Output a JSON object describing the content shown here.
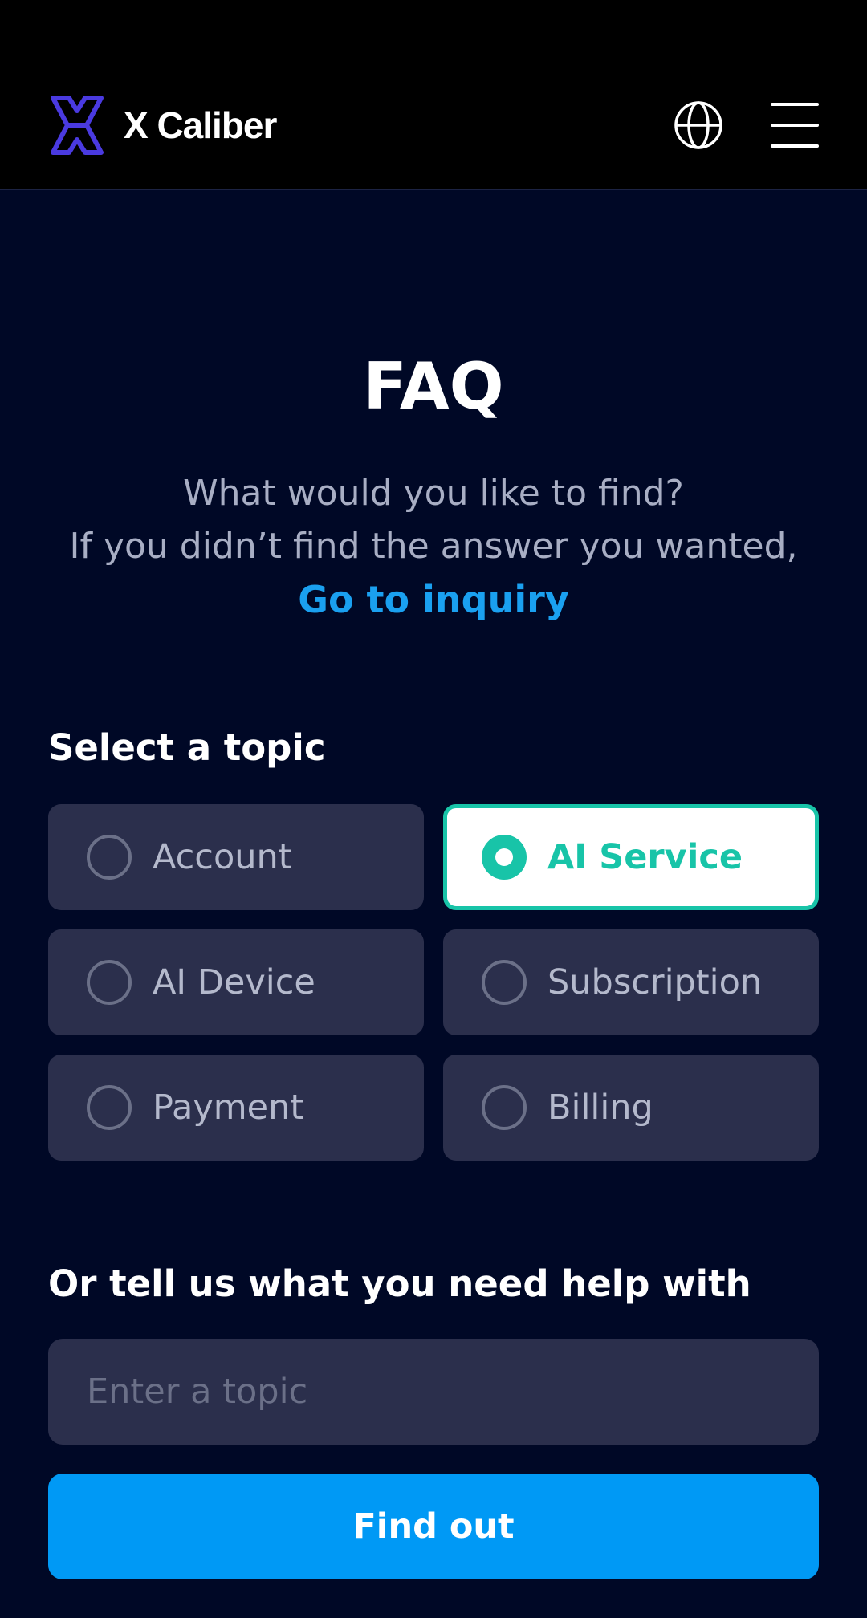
{
  "header": {
    "brand_name": "X Caliber",
    "logo_icon": "xcaliber-logo-icon",
    "globe_icon": "globe-icon",
    "menu_icon": "hamburger-menu-icon"
  },
  "main": {
    "title": "FAQ",
    "subtitle_line1": "What would you like to find?",
    "subtitle_line2": "If you didn’t find the answer you wanted,",
    "inquiry_link": "Go to inquiry"
  },
  "topics": {
    "heading": "Select a topic",
    "items": [
      {
        "label": "Account",
        "selected": false
      },
      {
        "label": "AI Service",
        "selected": true
      },
      {
        "label": "AI Device",
        "selected": false
      },
      {
        "label": "Subscription",
        "selected": false
      },
      {
        "label": "Payment",
        "selected": false
      },
      {
        "label": "Billing",
        "selected": false
      }
    ]
  },
  "search": {
    "heading": "Or tell us what you need help with",
    "placeholder": "Enter a topic",
    "value": "",
    "button_label": "Find out"
  },
  "colors": {
    "background": "#000826",
    "accent_blue": "#0099f5",
    "link_blue": "#1aa0f0",
    "selected_teal": "#18c4a8",
    "logo_purple": "#4a3ae0"
  }
}
